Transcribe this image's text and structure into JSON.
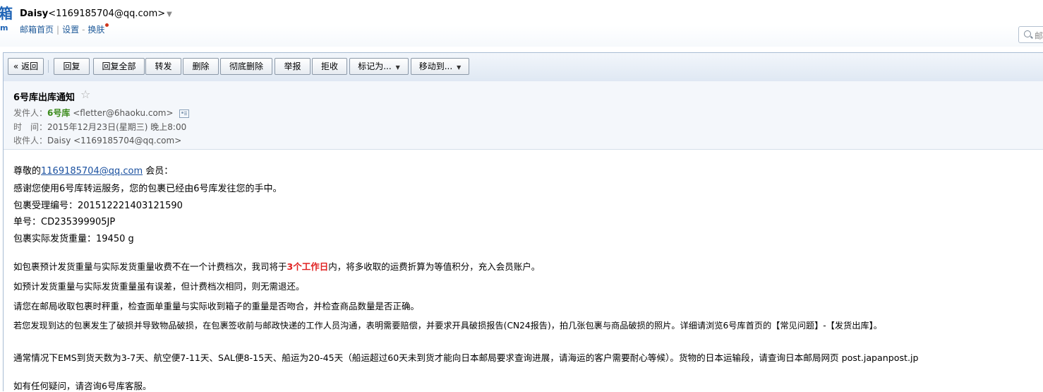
{
  "header": {
    "logo_fragment": "箱",
    "logo_fragment_sub": "m",
    "user_name": "Daisy",
    "user_email": "<1169185704@qq.com>",
    "nav": {
      "home": "邮箱首页",
      "settings": "设置",
      "skin": "换肤"
    },
    "search_placeholder": "邮"
  },
  "toolbar": {
    "back": "« 返回",
    "reply": "回复",
    "reply_all": "回复全部",
    "forward": "转发",
    "delete": "删除",
    "delete_perm": "彻底删除",
    "report": "举报",
    "reject": "拒收",
    "mark_as": "标记为...",
    "move_to": "移动到..."
  },
  "mail": {
    "subject": "6号库出库通知",
    "star": "☆",
    "from_label": "发件人：",
    "from_name": "6号库",
    "from_email": "<fletter@6haoku.com>",
    "time_label": "时　间：",
    "time_value": "2015年12月23日(星期三) 晚上8:00",
    "to_label": "收件人：",
    "to_value": "Daisy <1169185704@qq.com>"
  },
  "body": {
    "greet_prefix": "尊敬的",
    "greet_email": "1169185704@qq.com",
    "greet_suffix": " 会员：",
    "line1": "感谢您使用6号库转运服务，您的包裹已经由6号库发往您的手中。",
    "line2_label": "包裹受理编号：",
    "line2_value": "201512221403121590",
    "line3_label": "单号：",
    "line3_value": "CD235399905JP",
    "line4_label": "包裹实际发货重量：",
    "line4_value": "19450 g",
    "para1_pre": "如包裹预计发货重量与实际发货重量收费不在一个计费档次，我司将于",
    "para1_red": "3个工作日",
    "para1_post": "内，将多收取的运费折算为等值积分，充入会员账户。",
    "para2": "如预计发货重量与实际发货重量虽有误差，但计费档次相同，则无需退还。",
    "para3": "请您在邮局收取包裹时秤重，检查面单重量与实际收到箱子的重量是否吻合，并检查商品数量是否正确。",
    "para4": "若您发现到达的包裹发生了破损并导致物品破损，在包裹签收前与邮政快递的工作人员沟通，表明需要赔偿，并要求开具破损报告(CN24报告)，拍几张包裹与商品破损的照片。详细请浏览6号库首页的【常见问题】-【发货出库】。",
    "para5": "通常情况下EMS到货天数为3-7天、航空便7-11天、SAL便8-15天、船运为20-45天（船运超过60天未到货才能向日本邮局要求查询进展，请海运的客户需要耐心等候）。货物的日本运输段，请查询日本邮局网页 post.japanpost.jp",
    "para6": "如有任何疑问，请咨询6号库客服。"
  }
}
